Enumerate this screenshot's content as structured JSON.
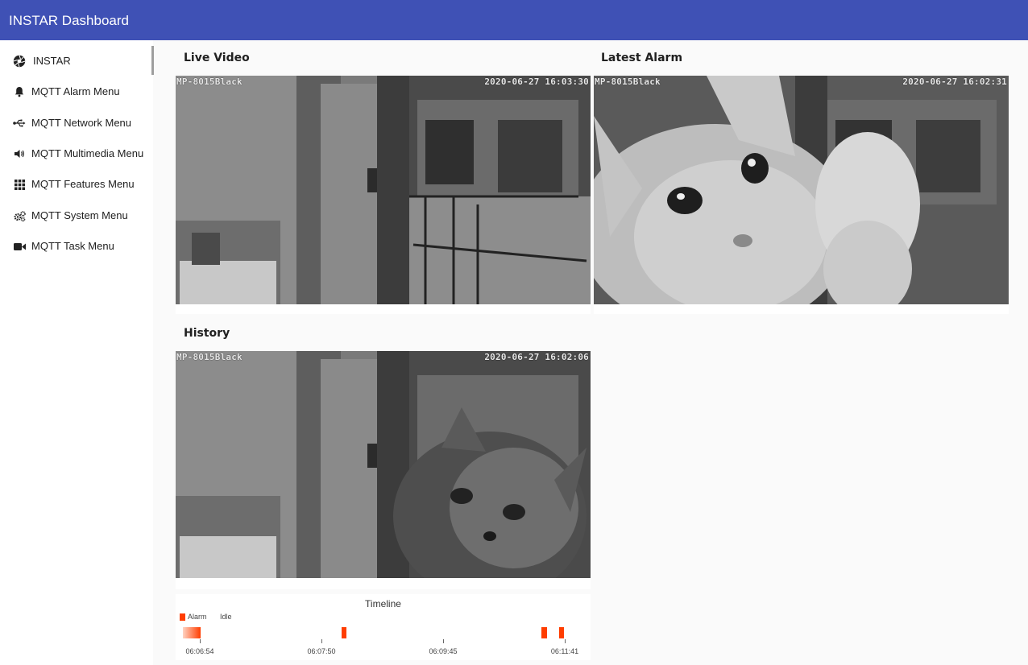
{
  "app": {
    "title": "INSTAR Dashboard"
  },
  "sidebar": {
    "items": [
      {
        "label": "INSTAR",
        "icon": "aperture-icon"
      },
      {
        "label": "MQTT Alarm Menu",
        "icon": "bell-icon"
      },
      {
        "label": "MQTT Network Menu",
        "icon": "usb-icon"
      },
      {
        "label": "MQTT Multimedia Menu",
        "icon": "volume-icon"
      },
      {
        "label": "MQTT Features Menu",
        "icon": "grid-icon"
      },
      {
        "label": "MQTT System Menu",
        "icon": "gears-icon"
      },
      {
        "label": "MQTT Task Menu",
        "icon": "video-camera-icon"
      }
    ]
  },
  "main": {
    "live_video": {
      "title": "Live Video",
      "camera_name": "MP-8015Black",
      "timestamp": "2020-06-27 16:03:30"
    },
    "latest_alarm": {
      "title": "Latest Alarm",
      "camera_name": "MP-8015Black",
      "timestamp": "2020-06-27 16:02:31"
    },
    "history": {
      "title": "History",
      "camera_name": "MP-8015Black",
      "timestamp": "2020-06-27 16:02:06"
    },
    "timeline": {
      "title": "Timeline",
      "legend": [
        {
          "label": "Alarm",
          "color": "#ff3d00"
        },
        {
          "label": "Idle",
          "color": "#ffffff"
        }
      ],
      "ticks": [
        "06:06:54",
        "06:07:50",
        "06:09:45",
        "06:11:41"
      ]
    }
  },
  "colors": {
    "appbar": "#3f51b5",
    "alarm": "#ff3d00",
    "background": "#fafafa"
  }
}
